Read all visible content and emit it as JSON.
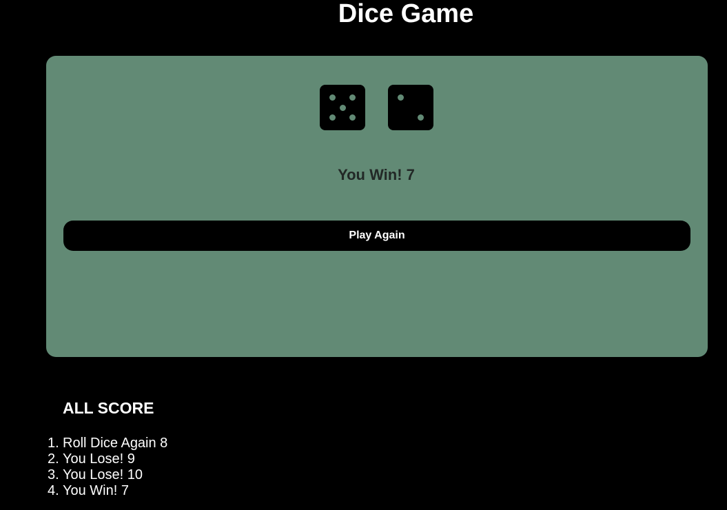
{
  "title": "Dice Game",
  "game": {
    "die1": 5,
    "die2": 2,
    "result": "You Win! 7",
    "play_again_label": "Play Again"
  },
  "scores": {
    "heading": "ALL SCORE",
    "items": [
      {
        "num": "1.",
        "text": "Roll Dice Again 8"
      },
      {
        "num": "2.",
        "text": "You Lose! 9"
      },
      {
        "num": "3.",
        "text": "You Lose! 10"
      },
      {
        "num": "4.",
        "text": "You Win! 7"
      }
    ]
  },
  "colors": {
    "background": "#000000",
    "card": "#628a75",
    "die": "#000000",
    "pip": "#628a75",
    "result_text": "#222826"
  }
}
